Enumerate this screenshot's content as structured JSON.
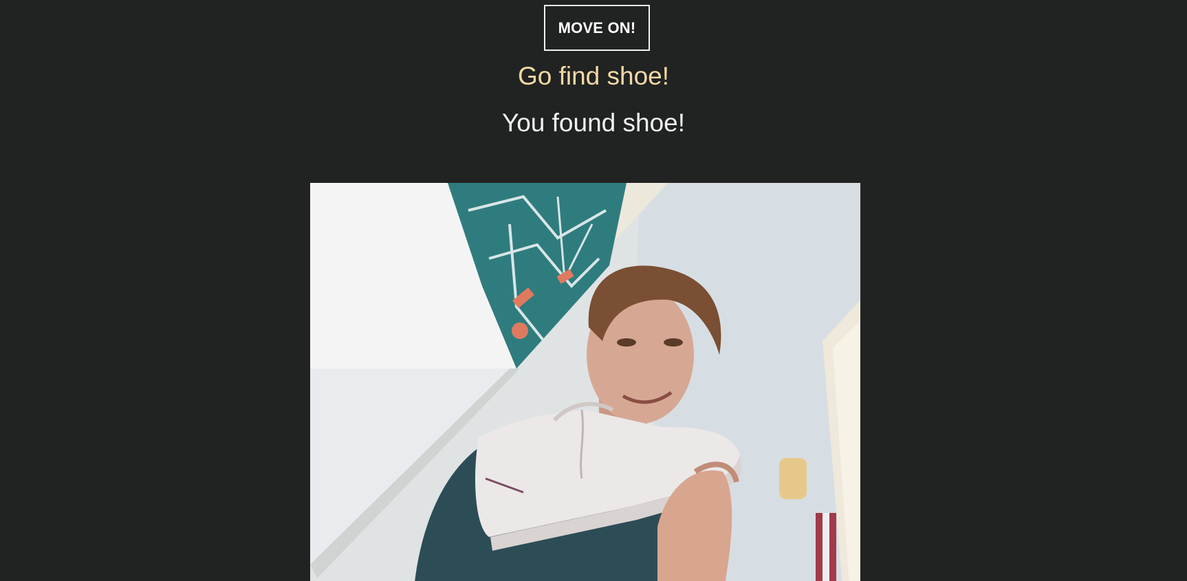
{
  "controls": {
    "move_on_label": "MOVE ON!"
  },
  "game": {
    "prompt": "Go find shoe!",
    "result": "You found shoe!"
  },
  "colors": {
    "background": "#212322",
    "prompt": "#f3d9a6",
    "result": "#f2f2f2",
    "button_border": "#f0f0f0"
  }
}
